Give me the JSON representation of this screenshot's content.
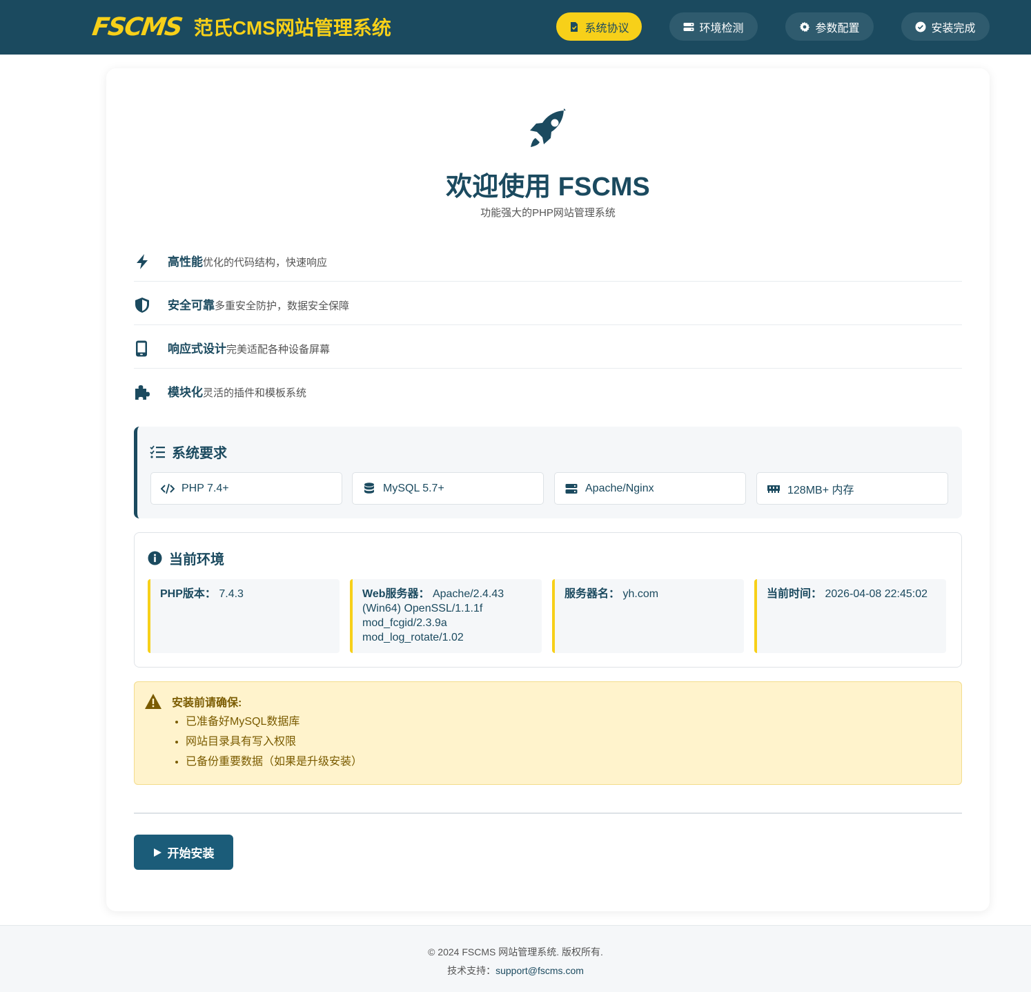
{
  "header": {
    "logo_mark": "FSCMS",
    "logo_text": "范氏CMS网站管理系统",
    "steps": [
      {
        "label": "系统协议",
        "icon": "document-icon",
        "active": true
      },
      {
        "label": "环境检测",
        "icon": "server-icon",
        "active": false
      },
      {
        "label": "参数配置",
        "icon": "gear-icon",
        "active": false
      },
      {
        "label": "安装完成",
        "icon": "check-circle-icon",
        "active": false
      }
    ]
  },
  "main": {
    "icon": "rocket-icon",
    "title": "欢迎使用 FSCMS",
    "subtitle": "功能强大的PHP网站管理系统",
    "features": [
      {
        "icon": "bolt-icon",
        "title": "高性能",
        "desc": "优化的代码结构，快速响应"
      },
      {
        "icon": "shield-icon",
        "title": "安全可靠",
        "desc": "多重安全防护，数据安全保障"
      },
      {
        "icon": "mobile-icon",
        "title": "响应式设计",
        "desc": "完美适配各种设备屏幕"
      },
      {
        "icon": "puzzle-icon",
        "title": "模块化",
        "desc": "灵活的插件和模板系统"
      }
    ],
    "requirements": {
      "title": "系统要求",
      "items": [
        {
          "icon": "code-icon",
          "label": "PHP 7.4+"
        },
        {
          "icon": "database-icon",
          "label": "MySQL 5.7+"
        },
        {
          "icon": "server-icon",
          "label": "Apache/Nginx"
        },
        {
          "icon": "memory-icon",
          "label": "128MB+ 内存"
        }
      ]
    },
    "environment": {
      "title": "当前环境",
      "items": [
        {
          "label": "PHP版本：",
          "value": "7.4.3"
        },
        {
          "label": "Web服务器：",
          "value": "Apache/2.4.43 (Win64) OpenSSL/1.1.1f mod_fcgid/2.3.9a mod_log_rotate/1.02"
        },
        {
          "label": "服务器名：",
          "value": "yh.com"
        },
        {
          "label": "当前时间：",
          "value": "2026-04-08 22:45:02"
        }
      ]
    },
    "warning": {
      "title": "安装前请确保:",
      "items": [
        "已准备好MySQL数据库",
        "网站目录具有写入权限",
        "已备份重要数据（如果是升级安装）"
      ]
    },
    "install_button": "开始安装"
  },
  "footer": {
    "copyright": "© 2024 FSCMS 网站管理系统. 版权所有.",
    "support_label": "技术支持：",
    "support_email": "support@fscms.com"
  },
  "colors": {
    "primary": "#1b4a5f",
    "accent": "#f7d019",
    "button": "#1b5c79",
    "warning_bg": "#fff3cc"
  }
}
